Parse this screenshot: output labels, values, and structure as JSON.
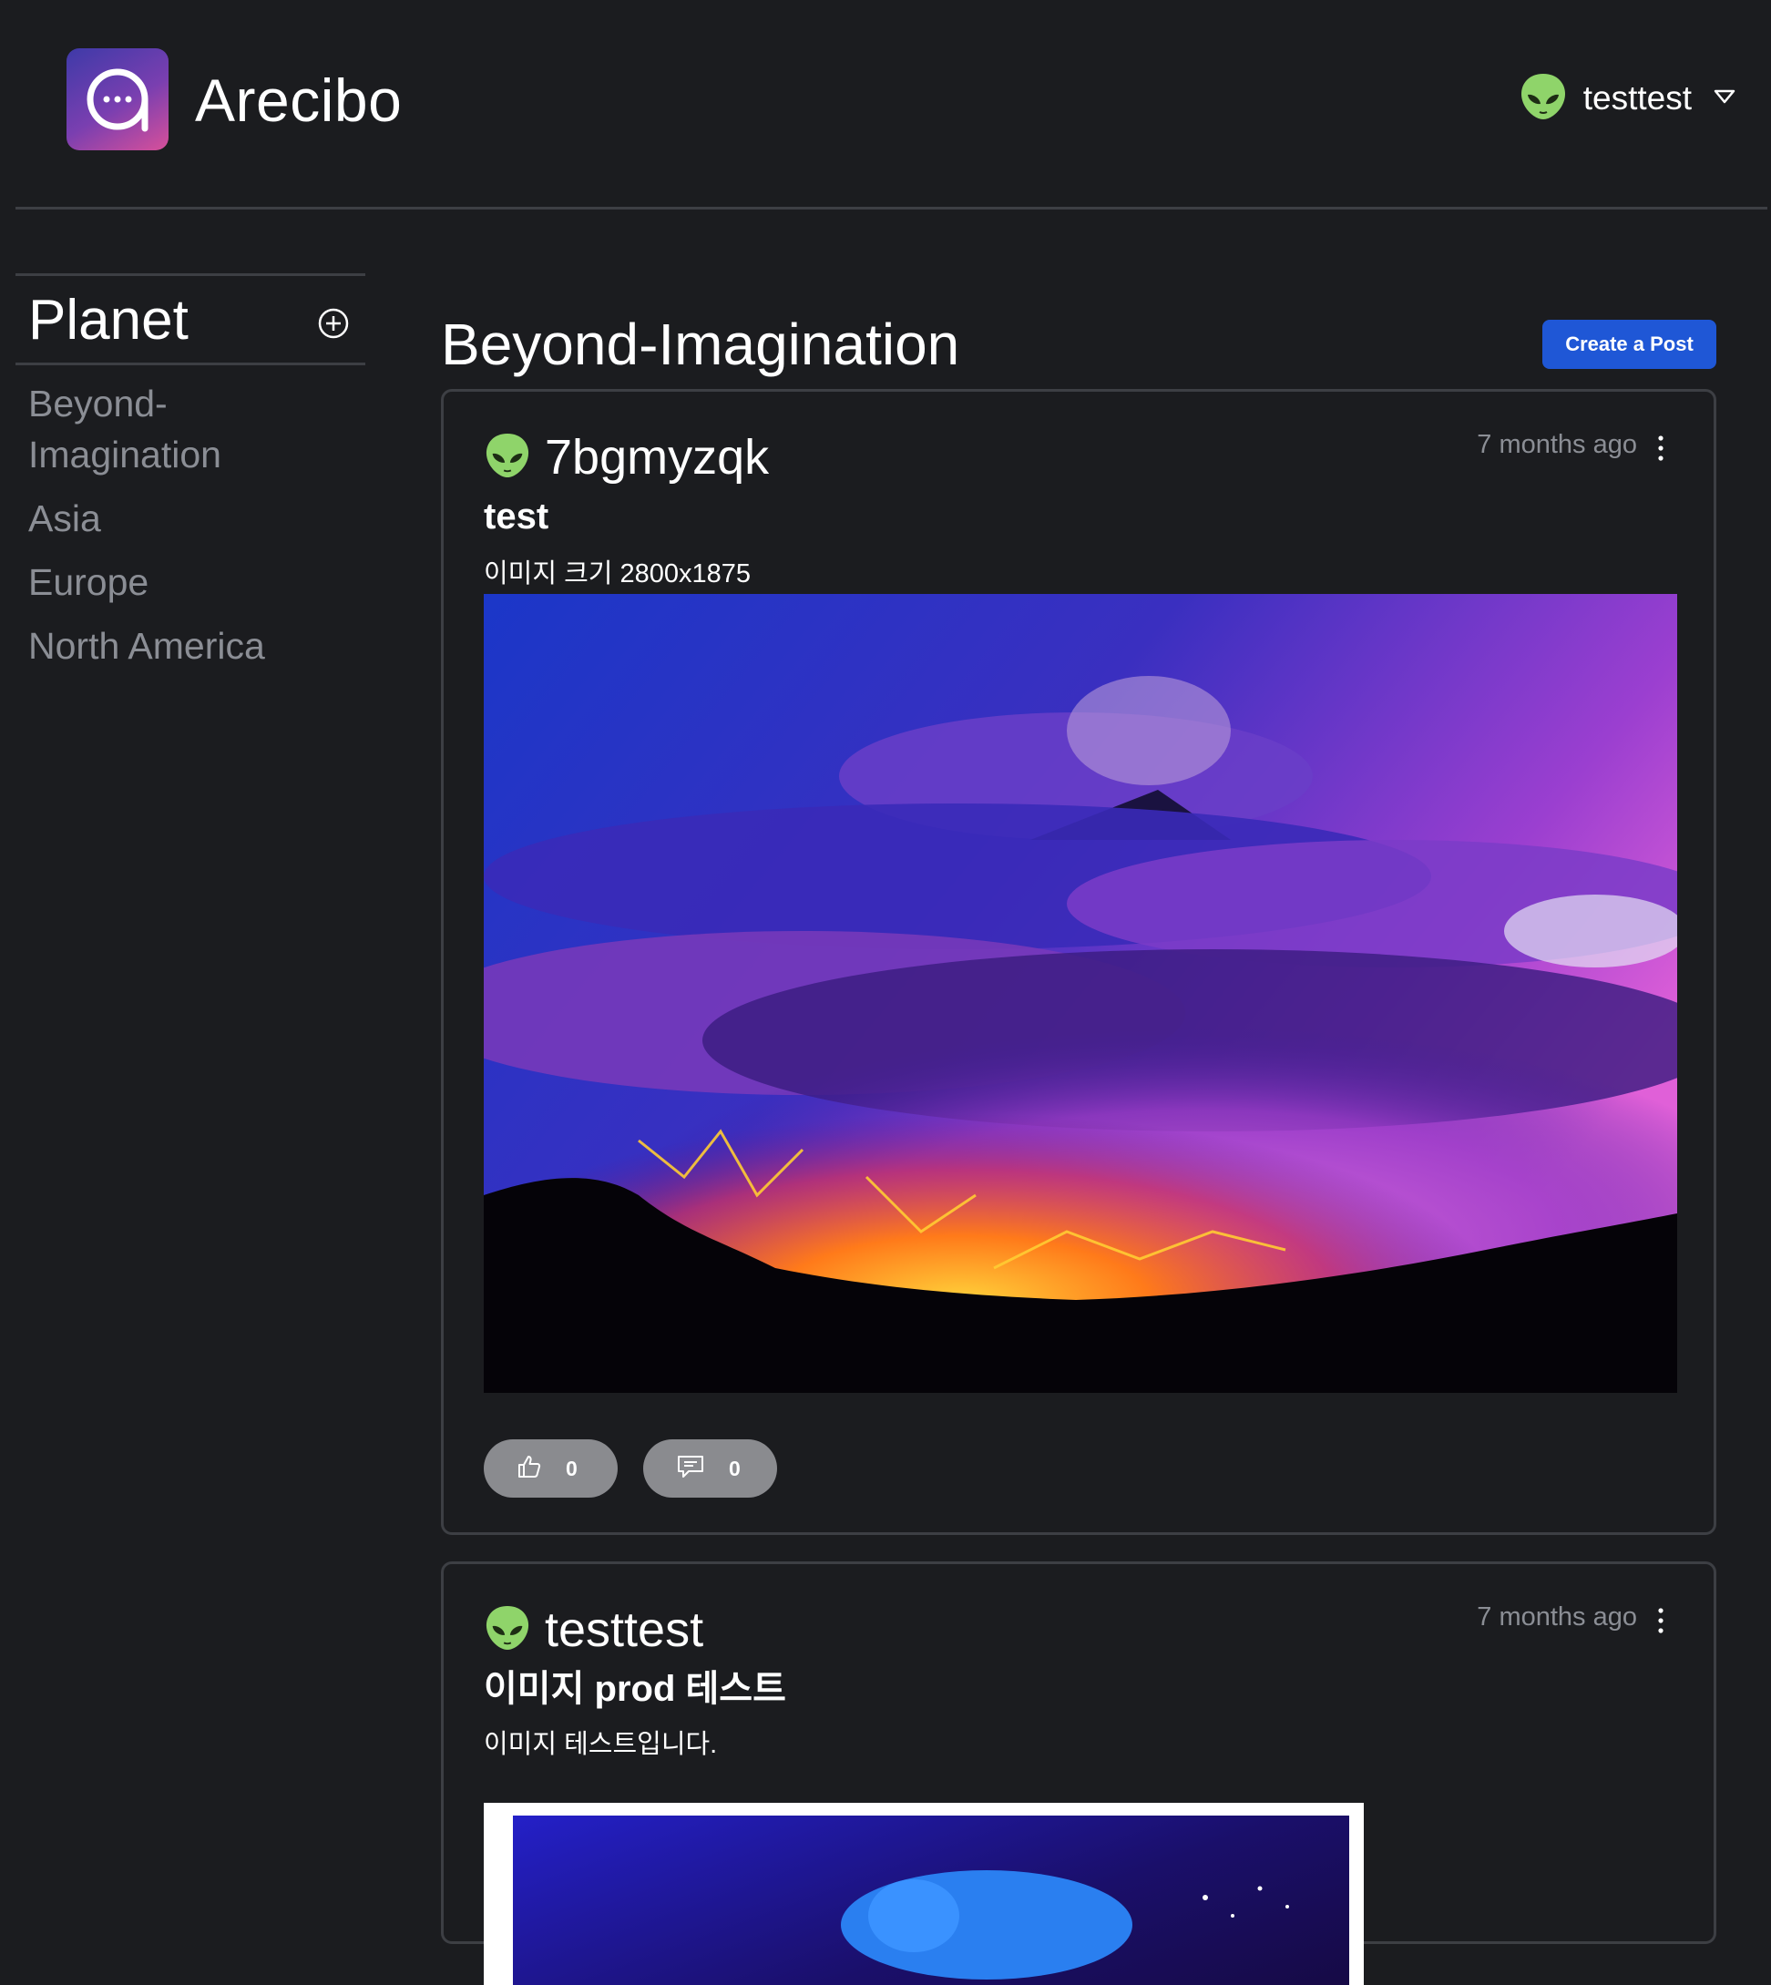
{
  "app": {
    "title": "Arecibo"
  },
  "user_menu": {
    "username": "testtest",
    "avatar_icon": "alien-icon"
  },
  "sidebar": {
    "title": "Planet",
    "add_icon": "plus-circle-icon",
    "items": [
      {
        "label": "Beyond-Imagination"
      },
      {
        "label": "Asia"
      },
      {
        "label": "Europe"
      },
      {
        "label": "North America"
      }
    ]
  },
  "main": {
    "page_title": "Beyond-Imagination",
    "create_post_label": "Create a Post",
    "posts": [
      {
        "author": "7bgmyzqk",
        "time": "7 months ago",
        "title": "test",
        "body": "이미지 크기 2800x1875",
        "image_icon": "volcano-photo",
        "likes": "0",
        "comments": "0"
      },
      {
        "author": "testtest",
        "time": "7 months ago",
        "title": "이미지 prod 테스트",
        "body": "이미지 테스트입니다.",
        "image_icon": "blue-art-photo"
      }
    ]
  },
  "colors": {
    "background": "#1b1c1f",
    "accent": "#1f57d6",
    "muted_text": "#8b8e95",
    "divider": "#3d3f44",
    "pill": "#8a8b8f"
  }
}
